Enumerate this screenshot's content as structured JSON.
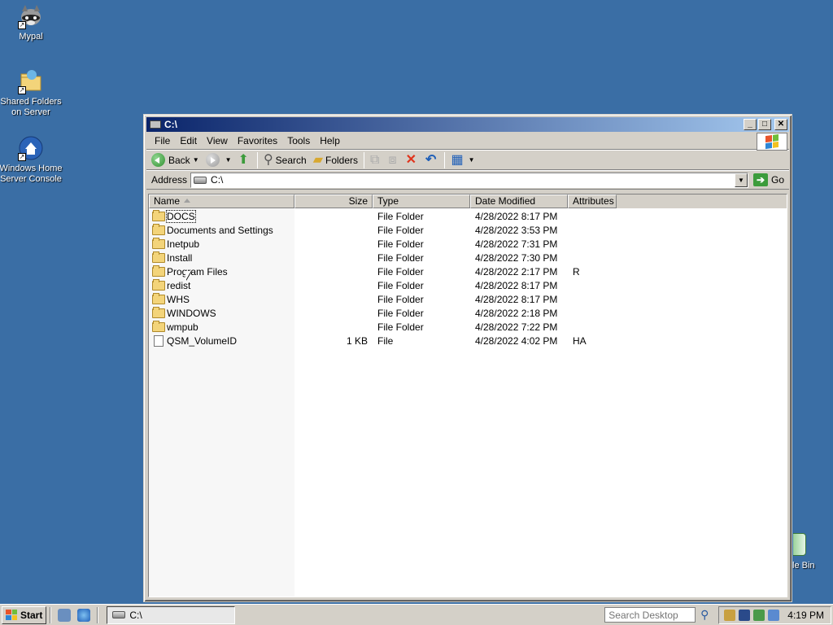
{
  "desktop": {
    "icons": [
      {
        "label": "Mypal",
        "icon": "raccoon-icon"
      },
      {
        "label": "Shared Folders on Server",
        "icon": "shared-folder-icon"
      },
      {
        "label": "Windows Home Server Console",
        "icon": "home-server-icon"
      }
    ],
    "recycle_bin_label": "le Bin"
  },
  "window": {
    "title": "C:\\",
    "menu": [
      "File",
      "Edit",
      "View",
      "Favorites",
      "Tools",
      "Help"
    ],
    "toolbar": {
      "back": "Back",
      "search": "Search",
      "folders": "Folders"
    },
    "address": {
      "label": "Address",
      "value": "C:\\",
      "go": "Go"
    },
    "columns": {
      "name": "Name",
      "size": "Size",
      "type": "Type",
      "date": "Date Modified",
      "attributes": "Attributes"
    },
    "rows": [
      {
        "name": "DOCS",
        "size": "",
        "type": "File Folder",
        "date": "4/28/2022 8:17 PM",
        "attr": "",
        "kind": "folder"
      },
      {
        "name": "Documents and Settings",
        "size": "",
        "type": "File Folder",
        "date": "4/28/2022 3:53 PM",
        "attr": "",
        "kind": "folder"
      },
      {
        "name": "Inetpub",
        "size": "",
        "type": "File Folder",
        "date": "4/28/2022 7:31 PM",
        "attr": "",
        "kind": "folder"
      },
      {
        "name": "Install",
        "size": "",
        "type": "File Folder",
        "date": "4/28/2022 7:30 PM",
        "attr": "",
        "kind": "folder"
      },
      {
        "name": "Program Files",
        "size": "",
        "type": "File Folder",
        "date": "4/28/2022 2:17 PM",
        "attr": "R",
        "kind": "folder"
      },
      {
        "name": "redist",
        "size": "",
        "type": "File Folder",
        "date": "4/28/2022 8:17 PM",
        "attr": "",
        "kind": "folder"
      },
      {
        "name": "WHS",
        "size": "",
        "type": "File Folder",
        "date": "4/28/2022 8:17 PM",
        "attr": "",
        "kind": "folder"
      },
      {
        "name": "WINDOWS",
        "size": "",
        "type": "File Folder",
        "date": "4/28/2022 2:18 PM",
        "attr": "",
        "kind": "folder"
      },
      {
        "name": "wmpub",
        "size": "",
        "type": "File Folder",
        "date": "4/28/2022 7:22 PM",
        "attr": "",
        "kind": "folder"
      },
      {
        "name": "QSM_VolumeID",
        "size": "1 KB",
        "type": "File",
        "date": "4/28/2022 4:02 PM",
        "attr": "HA",
        "kind": "file"
      }
    ]
  },
  "taskbar": {
    "start": "Start",
    "task": "C:\\",
    "search_placeholder": "Search Desktop",
    "clock": "4:19 PM"
  },
  "colors": {
    "desktop": "#3a6ea5",
    "titlebar_start": "#0a246a",
    "titlebar_end": "#a6caf0",
    "chrome": "#d4d0c8"
  }
}
